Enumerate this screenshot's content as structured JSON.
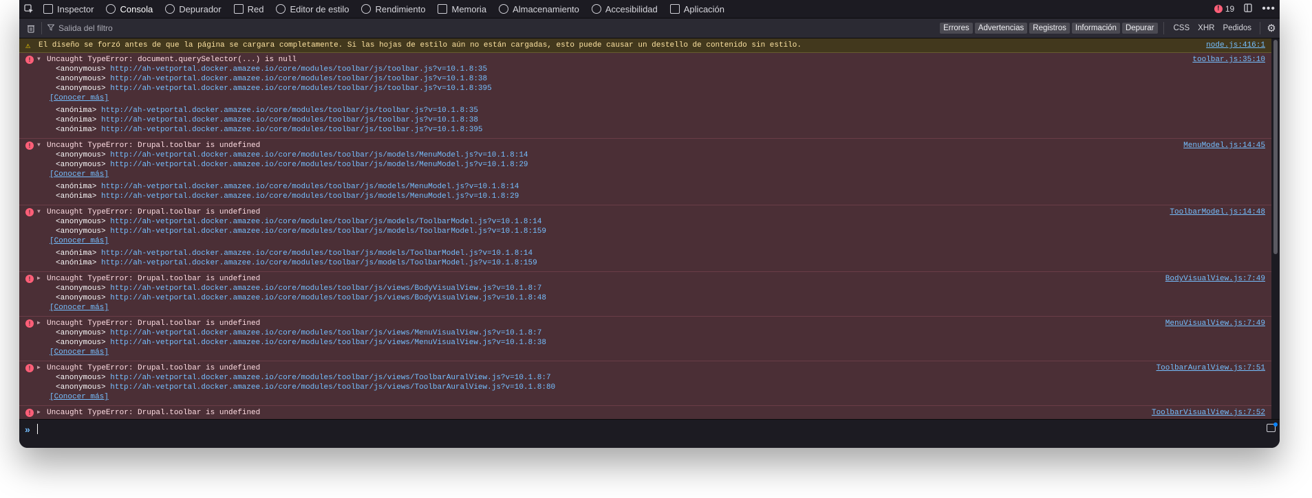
{
  "toolbar": {
    "tabs": [
      {
        "label": "Inspector",
        "icon": "inspector-icon"
      },
      {
        "label": "Consola",
        "icon": "console-icon"
      },
      {
        "label": "Depurador",
        "icon": "debugger-icon"
      },
      {
        "label": "Red",
        "icon": "network-icon"
      },
      {
        "label": "Editor de estilo",
        "icon": "style-editor-icon"
      },
      {
        "label": "Rendimiento",
        "icon": "performance-icon"
      },
      {
        "label": "Memoria",
        "icon": "memory-icon"
      },
      {
        "label": "Almacenamiento",
        "icon": "storage-icon"
      },
      {
        "label": "Accesibilidad",
        "icon": "accessibility-icon"
      },
      {
        "label": "Aplicación",
        "icon": "application-icon"
      }
    ],
    "active_tab": "Consola",
    "error_count": "19"
  },
  "filterbar": {
    "placeholder": "Salida del filtro",
    "buttons": [
      "Errores",
      "Advertencias",
      "Registros",
      "Información",
      "Depurar"
    ],
    "plain": [
      "CSS",
      "XHR",
      "Pedidos"
    ]
  },
  "warning": {
    "text": "El diseño se forzó antes de que la página se cargara completamente. Si las hojas de estilo aún no están cargadas, esto puede causar un destello de contenido sin estilo.",
    "location": "node.js:416:1"
  },
  "messages": [
    {
      "title": "Uncaught TypeError: document.querySelector(...) is null",
      "location": "toolbar.js:35:10",
      "expanded": true,
      "frames": [
        {
          "fn": "<anonymous>",
          "url": "http://ah-vetportal.docker.amazee.io/core/modules/toolbar/js/toolbar.js?v=10.1.8:35"
        },
        {
          "fn": "<anonymous>",
          "url": "http://ah-vetportal.docker.amazee.io/core/modules/toolbar/js/toolbar.js?v=10.1.8:38"
        },
        {
          "fn": "<anonymous>",
          "url": "http://ah-vetportal.docker.amazee.io/core/modules/toolbar/js/toolbar.js?v=10.1.8:395"
        }
      ],
      "learn_more": "[Conocer más]",
      "trace": [
        {
          "fn": "<anónima>",
          "url": "http://ah-vetportal.docker.amazee.io/core/modules/toolbar/js/toolbar.js?v=10.1.8:35"
        },
        {
          "fn": "<anónima>",
          "url": "http://ah-vetportal.docker.amazee.io/core/modules/toolbar/js/toolbar.js?v=10.1.8:38"
        },
        {
          "fn": "<anónima>",
          "url": "http://ah-vetportal.docker.amazee.io/core/modules/toolbar/js/toolbar.js?v=10.1.8:395"
        }
      ]
    },
    {
      "title": "Uncaught TypeError: Drupal.toolbar is undefined",
      "location": "MenuModel.js:14:45",
      "expanded": true,
      "frames": [
        {
          "fn": "<anonymous>",
          "url": "http://ah-vetportal.docker.amazee.io/core/modules/toolbar/js/models/MenuModel.js?v=10.1.8:14"
        },
        {
          "fn": "<anonymous>",
          "url": "http://ah-vetportal.docker.amazee.io/core/modules/toolbar/js/models/MenuModel.js?v=10.1.8:29"
        }
      ],
      "learn_more": "[Conocer más]",
      "trace": [
        {
          "fn": "<anónima>",
          "url": "http://ah-vetportal.docker.amazee.io/core/modules/toolbar/js/models/MenuModel.js?v=10.1.8:14"
        },
        {
          "fn": "<anónima>",
          "url": "http://ah-vetportal.docker.amazee.io/core/modules/toolbar/js/models/MenuModel.js?v=10.1.8:29"
        }
      ]
    },
    {
      "title": "Uncaught TypeError: Drupal.toolbar is undefined",
      "location": "ToolbarModel.js:14:48",
      "expanded": true,
      "frames": [
        {
          "fn": "<anonymous>",
          "url": "http://ah-vetportal.docker.amazee.io/core/modules/toolbar/js/models/ToolbarModel.js?v=10.1.8:14"
        },
        {
          "fn": "<anonymous>",
          "url": "http://ah-vetportal.docker.amazee.io/core/modules/toolbar/js/models/ToolbarModel.js?v=10.1.8:159"
        }
      ],
      "learn_more": "[Conocer más]",
      "trace": [
        {
          "fn": "<anónima>",
          "url": "http://ah-vetportal.docker.amazee.io/core/modules/toolbar/js/models/ToolbarModel.js?v=10.1.8:14"
        },
        {
          "fn": "<anónima>",
          "url": "http://ah-vetportal.docker.amazee.io/core/modules/toolbar/js/models/ToolbarModel.js?v=10.1.8:159"
        }
      ]
    },
    {
      "title": "Uncaught TypeError: Drupal.toolbar is undefined",
      "location": "BodyVisualView.js:7:49",
      "expanded": false,
      "frames": [
        {
          "fn": "<anonymous>",
          "url": "http://ah-vetportal.docker.amazee.io/core/modules/toolbar/js/views/BodyVisualView.js?v=10.1.8:7"
        },
        {
          "fn": "<anonymous>",
          "url": "http://ah-vetportal.docker.amazee.io/core/modules/toolbar/js/views/BodyVisualView.js?v=10.1.8:48"
        }
      ],
      "learn_more": "[Conocer más]",
      "trace": []
    },
    {
      "title": "Uncaught TypeError: Drupal.toolbar is undefined",
      "location": "MenuVisualView.js:7:49",
      "expanded": false,
      "frames": [
        {
          "fn": "<anonymous>",
          "url": "http://ah-vetportal.docker.amazee.io/core/modules/toolbar/js/views/MenuVisualView.js?v=10.1.8:7"
        },
        {
          "fn": "<anonymous>",
          "url": "http://ah-vetportal.docker.amazee.io/core/modules/toolbar/js/views/MenuVisualView.js?v=10.1.8:38"
        }
      ],
      "learn_more": "[Conocer más]",
      "trace": []
    },
    {
      "title": "Uncaught TypeError: Drupal.toolbar is undefined",
      "location": "ToolbarAuralView.js:7:51",
      "expanded": false,
      "frames": [
        {
          "fn": "<anonymous>",
          "url": "http://ah-vetportal.docker.amazee.io/core/modules/toolbar/js/views/ToolbarAuralView.js?v=10.1.8:7"
        },
        {
          "fn": "<anonymous>",
          "url": "http://ah-vetportal.docker.amazee.io/core/modules/toolbar/js/views/ToolbarAuralView.js?v=10.1.8:80"
        }
      ],
      "learn_more": "[Conocer más]",
      "trace": []
    },
    {
      "title": "Uncaught TypeError: Drupal.toolbar is undefined",
      "location": "ToolbarVisualView.js:7:52",
      "expanded": false,
      "frames": [],
      "learn_more": "",
      "trace": []
    }
  ],
  "colors": {
    "error_bg": "#4b2f36",
    "warning_bg": "#42381d",
    "link": "#75bfff",
    "error_icon": "#ff5f78"
  }
}
